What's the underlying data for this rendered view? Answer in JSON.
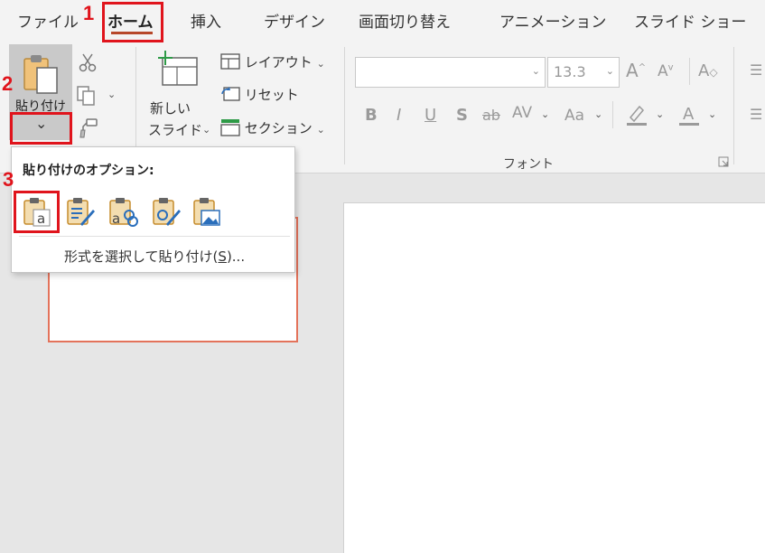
{
  "tabs": [
    {
      "label": "ファイル"
    },
    {
      "label": "ホーム",
      "active": true
    },
    {
      "label": "挿入"
    },
    {
      "label": "デザイン"
    },
    {
      "label": "画面切り替え"
    },
    {
      "label": "アニメーション"
    },
    {
      "label": "スライド ショー"
    }
  ],
  "clipboard": {
    "paste_label": "貼り付け",
    "paste_dropdown_arrow": "⌄"
  },
  "slides": {
    "new_slide_line1": "新しい",
    "new_slide_line2": "スライド",
    "layout": "レイアウト",
    "reset": "リセット",
    "section": "セクション"
  },
  "font": {
    "font_name": "",
    "font_size": "13.3",
    "group_label": "フォント",
    "buttons": [
      "B",
      "I",
      "U",
      "S",
      "ab",
      "AV",
      "Aa"
    ]
  },
  "paste_options": {
    "title": "貼り付けのオプション:",
    "special_prefix": "形式を選択して貼り付け(",
    "special_key": "S",
    "special_suffix": ")...",
    "options": [
      {
        "icon": "paste-use-destination-theme-icon"
      },
      {
        "icon": "paste-keep-source-formatting-icon"
      },
      {
        "icon": "paste-embed-icon"
      },
      {
        "icon": "paste-keep-source-formatting-alt-icon"
      },
      {
        "icon": "paste-as-picture-icon"
      }
    ]
  },
  "annotations": {
    "step1": "1",
    "step2": "2",
    "step3": "3",
    "color": "#e0141c"
  },
  "colors": {
    "accent": "#b7472a",
    "thumb_border": "#e3735b"
  }
}
